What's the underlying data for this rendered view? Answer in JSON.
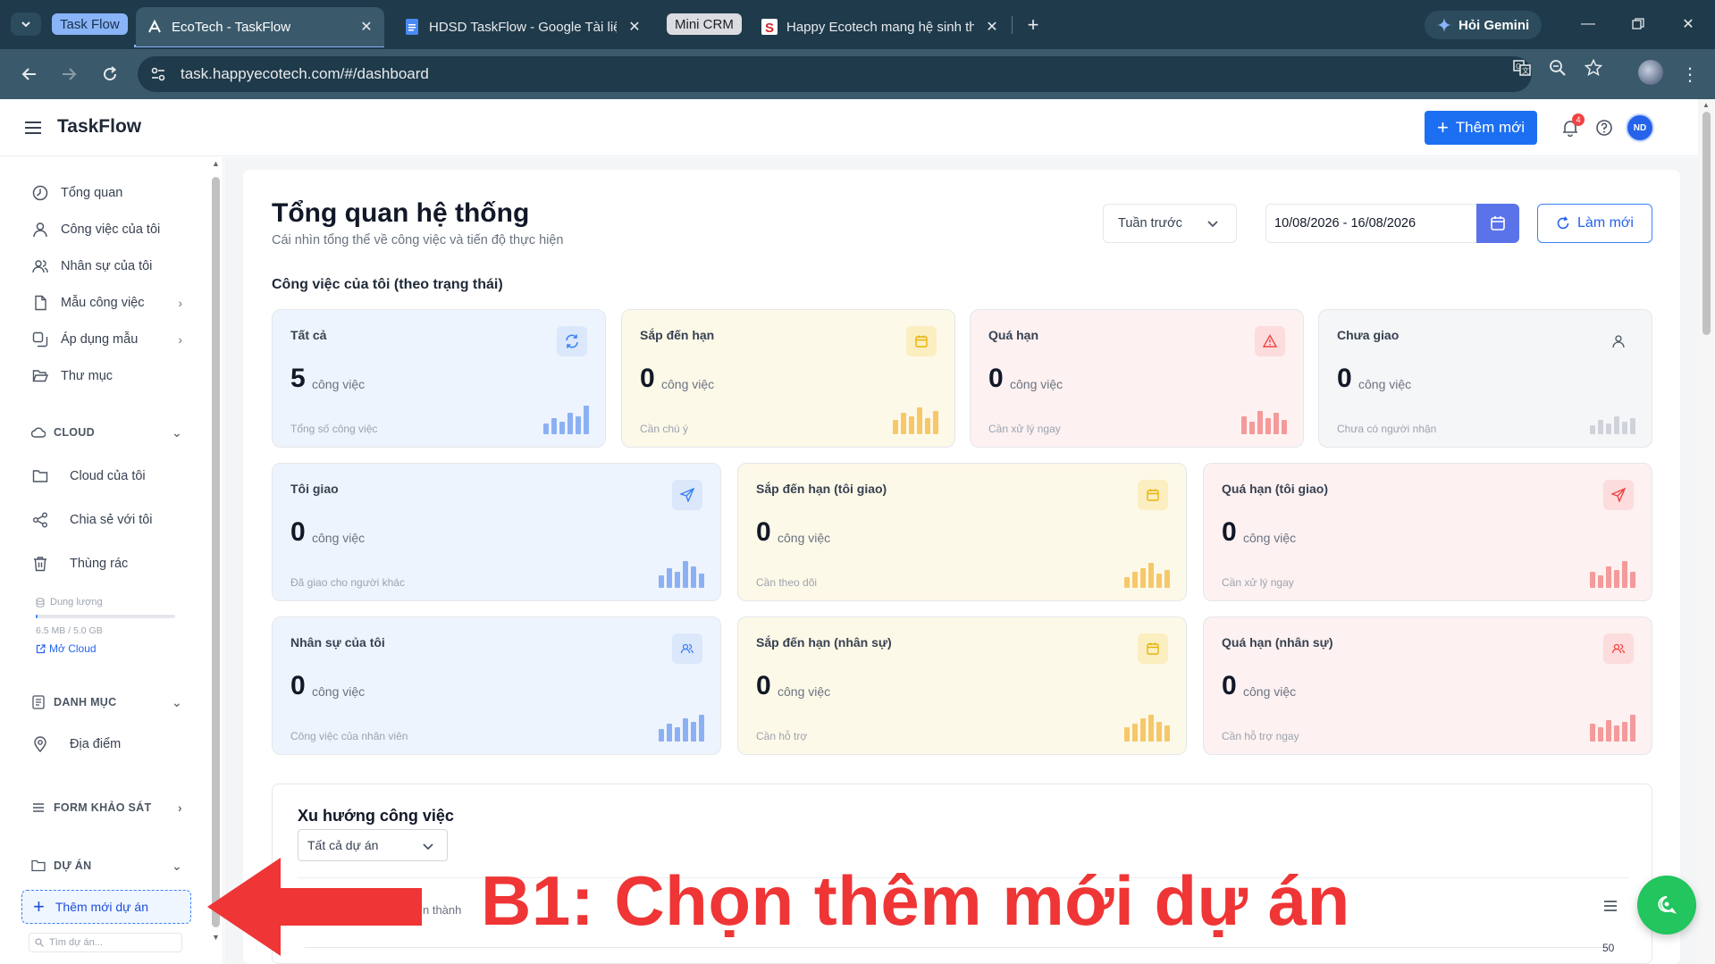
{
  "browser": {
    "tab_groups": [
      {
        "label": "Task Flow",
        "color": "#8ab4f8"
      },
      {
        "label": "Mini CRM",
        "color": "#dadce0"
      }
    ],
    "tabs": [
      {
        "title": "EcoTech - TaskFlow",
        "active": true
      },
      {
        "title": "HDSD TaskFlow - Google Tài liệ",
        "active": false
      },
      {
        "title": "Happy Ecotech mang hệ sinh th",
        "active": false
      }
    ],
    "gemini_label": "Hỏi Gemini",
    "url": "task.happyecotech.com/#/dashboard"
  },
  "header": {
    "brand": "TaskFlow",
    "add_new_label": "Thêm mới",
    "notification_count": "4",
    "avatar_initials": "ND"
  },
  "sidebar": {
    "items": [
      {
        "label": "Tổng quan",
        "icon": "clock-icon"
      },
      {
        "label": "Công việc của tôi",
        "icon": "user-icon"
      },
      {
        "label": "Nhân sự của tôi",
        "icon": "users-icon"
      },
      {
        "label": "Mẫu công việc",
        "icon": "file-icon"
      },
      {
        "label": "Áp dụng mẫu",
        "icon": "copy-icon"
      },
      {
        "label": "Thư mục",
        "icon": "folder-open-icon"
      }
    ],
    "cloud": {
      "section_label": "CLOUD",
      "items": [
        {
          "label": "Cloud của tôi",
          "icon": "folder-icon"
        },
        {
          "label": "Chia sẻ với tôi",
          "icon": "share-icon"
        },
        {
          "label": "Thùng rác",
          "icon": "trash-icon"
        }
      ],
      "storage_label": "Dung lượng",
      "storage_used": "6.5 MB / 5.0 GB",
      "storage_fraction": 0.0013,
      "open_cloud_label": "Mở Cloud"
    },
    "catalog": {
      "section_label": "DANH MỤC",
      "items": [
        {
          "label": "Địa điểm",
          "icon": "map-pin-icon"
        }
      ]
    },
    "survey": {
      "section_label": "FORM KHẢO SÁT"
    },
    "project": {
      "section_label": "DỰ ÁN",
      "add_project_label": "Thêm mới dự án",
      "search_placeholder": "Tìm dự án..."
    }
  },
  "main": {
    "title": "Tổng quan hệ thống",
    "subtitle": "Cái nhìn tổng thể về công việc và tiến độ thực hiện",
    "period": "Tuần trước",
    "date_range": "10/08/2026 - 16/08/2026",
    "refresh_label": "Làm mới",
    "section_title": "Công việc của tôi (theo trạng thái)",
    "unit": "công việc",
    "cards_row1": [
      {
        "title": "Tất cả",
        "count": "5",
        "note": "Tổng số công việc",
        "theme": "blue",
        "icon": "refresh-icon"
      },
      {
        "title": "Sắp đến hạn",
        "count": "0",
        "note": "Cần chú ý",
        "theme": "yellow",
        "icon": "calendar-icon"
      },
      {
        "title": "Quá hạn",
        "count": "0",
        "note": "Cần xử lý ngay",
        "theme": "red",
        "icon": "warning-icon"
      },
      {
        "title": "Chưa giao",
        "count": "0",
        "note": "Chưa có người nhận",
        "theme": "grey",
        "icon": "user-icon"
      }
    ],
    "cards_row2": [
      {
        "title": "Tôi giao",
        "count": "0",
        "note": "Đã giao cho người khác",
        "theme": "blue",
        "icon": "send-icon"
      },
      {
        "title": "Sắp đến hạn (tôi giao)",
        "count": "0",
        "note": "Cần theo dõi",
        "theme": "yellow",
        "icon": "calendar-icon"
      },
      {
        "title": "Quá hạn (tôi giao)",
        "count": "0",
        "note": "Cần xử lý ngay",
        "theme": "red",
        "icon": "send-icon"
      }
    ],
    "cards_row3": [
      {
        "title": "Nhân sự của tôi",
        "count": "0",
        "note": "Công việc của nhân viên",
        "theme": "blue",
        "icon": "users-icon"
      },
      {
        "title": "Sắp đến hạn (nhân sự)",
        "count": "0",
        "note": "Cần hỗ trợ",
        "theme": "yellow",
        "icon": "calendar-icon"
      },
      {
        "title": "Quá hạn (nhân sự)",
        "count": "0",
        "note": "Cần hỗ trợ ngay",
        "theme": "red",
        "icon": "users-icon"
      }
    ],
    "trend": {
      "title": "Xu hướng công việc",
      "filter": "Tất cả dự án",
      "legend_fragment": "n thành",
      "y_max": "50"
    }
  },
  "annotation": {
    "text": "B1: Chọn thêm mới dự án",
    "color": "#ef3535"
  },
  "colors": {
    "primary": "#1d6ff2",
    "blue_theme": "#eef4fd",
    "yellow_theme": "#fdf9e8",
    "red_theme": "#fdf1f1",
    "grey_theme": "#f5f6f8",
    "chat": "#22c55e"
  }
}
